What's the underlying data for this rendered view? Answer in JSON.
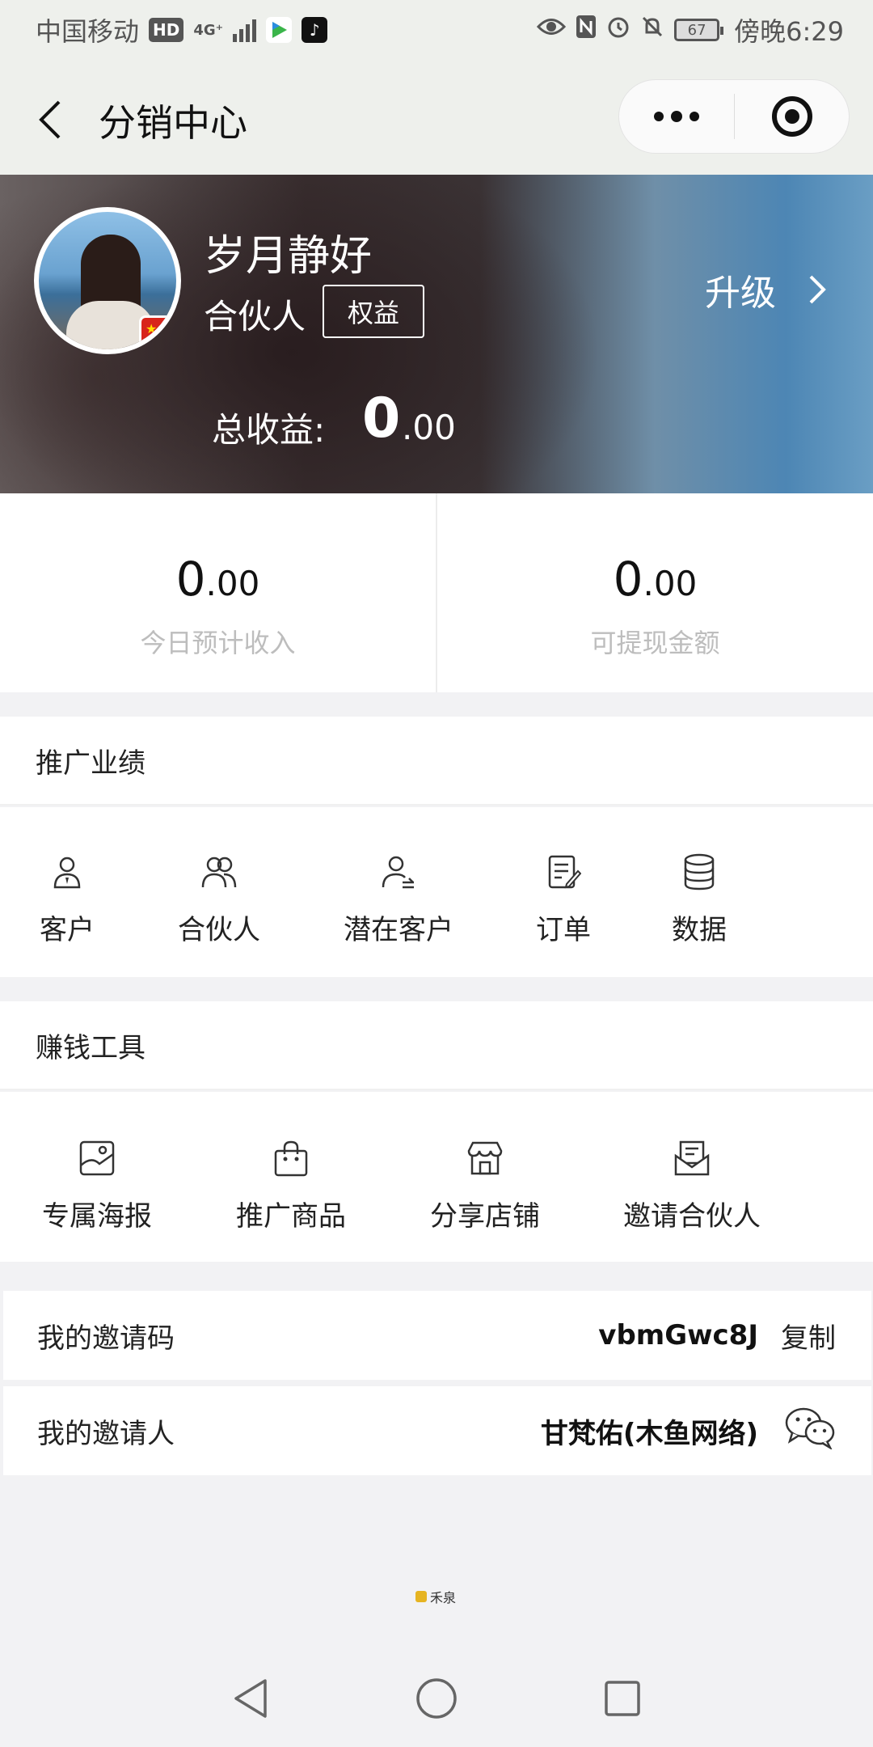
{
  "status_bar": {
    "carrier": "中国移动",
    "hd_badge": "HD",
    "network": "4G⁺",
    "battery": "67",
    "time": "傍晚6:29"
  },
  "nav": {
    "title": "分销中心"
  },
  "hero": {
    "name": "岁月静好",
    "role": "合伙人",
    "rights_label": "权益",
    "upgrade_label": "升级",
    "earnings_label": "总收益:",
    "earnings_int": "0",
    "earnings_dec": ".00"
  },
  "stats": [
    {
      "int": "0",
      "dec": ".00",
      "label": "今日预计收入"
    },
    {
      "int": "0",
      "dec": ".00",
      "label": "可提现金额"
    }
  ],
  "promo": {
    "title": "推广业绩",
    "items": [
      {
        "label": "客户",
        "icon": "customer-icon"
      },
      {
        "label": "合伙人",
        "icon": "partners-icon"
      },
      {
        "label": "潜在客户",
        "icon": "potential-customer-icon"
      },
      {
        "label": "订单",
        "icon": "order-icon"
      },
      {
        "label": "数据",
        "icon": "database-icon"
      }
    ]
  },
  "tools": {
    "title": "赚钱工具",
    "items": [
      {
        "label": "专属海报",
        "icon": "poster-icon"
      },
      {
        "label": "推广商品",
        "icon": "shopping-bag-icon"
      },
      {
        "label": "分享店铺",
        "icon": "store-icon"
      },
      {
        "label": "邀请合伙人",
        "icon": "invite-envelope-icon"
      }
    ]
  },
  "invite": {
    "code_label": "我的邀请码",
    "code_value": "vbmGwc8J",
    "copy_label": "复制",
    "inviter_label": "我的邀请人",
    "inviter_value": "甘梵佑(木鱼网络)"
  },
  "watermark": "禾泉",
  "colors": {
    "page_bg": "#f2f2f4",
    "bar_bg": "#eef0ec",
    "muted_text": "#bdbdbd"
  }
}
